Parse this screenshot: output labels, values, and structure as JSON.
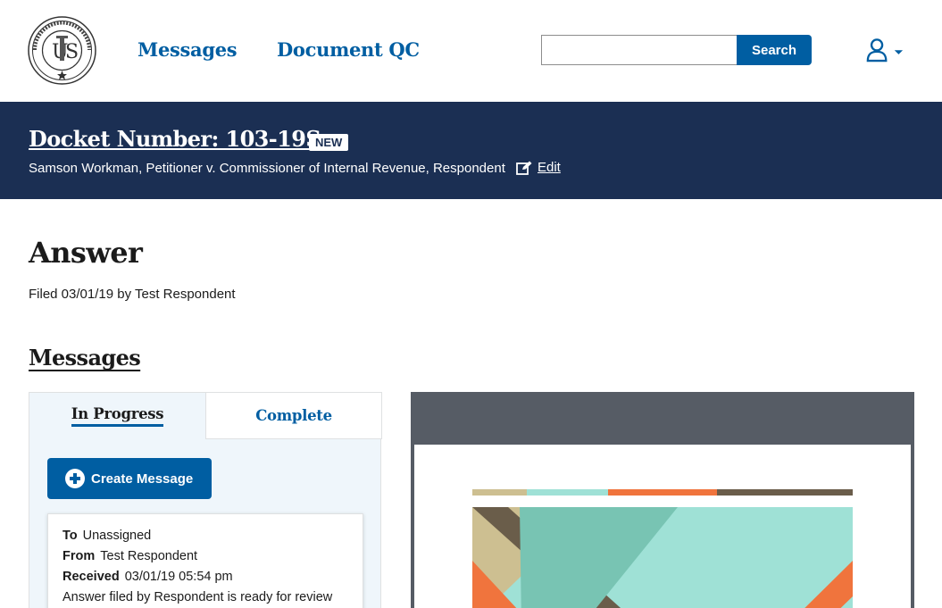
{
  "header": {
    "nav": {
      "messages": "Messages",
      "document_qc": "Document QC"
    },
    "search": {
      "value": "",
      "button_label": "Search"
    }
  },
  "banner": {
    "docket_title": "Docket Number: 103-19S",
    "badge": "NEW",
    "caption": "Samson Workman, Petitioner v. Commissioner of Internal Revenue, Respondent",
    "edit_label": "Edit"
  },
  "document": {
    "title": "Answer",
    "filed_text": "Filed 03/01/19 by Test Respondent"
  },
  "messages": {
    "heading": "Messages",
    "tabs": {
      "in_progress": "In Progress",
      "complete": "Complete"
    },
    "create_label": "Create Message",
    "card": {
      "to_label": "To",
      "to_value": "Unassigned",
      "from_label": "From",
      "from_value": "Test Respondent",
      "received_label": "Received",
      "received_value": "03/01/19 05:54 pm",
      "body": "Answer filed by Respondent is ready for review"
    }
  },
  "colors": {
    "primary": "#005ea2",
    "banner": "#1b2f53",
    "panel_bg": "#eff6fb",
    "preview_bg": "#565c65"
  }
}
